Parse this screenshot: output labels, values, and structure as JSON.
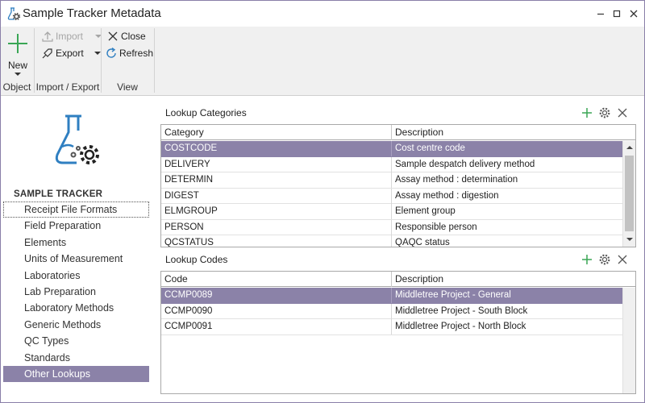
{
  "window": {
    "title": "Sample Tracker Metadata"
  },
  "ribbon": {
    "groups": {
      "object": "Object",
      "import_export": "Import / Export",
      "view": "View"
    },
    "new_label": "New",
    "import_label": "Import",
    "export_label": "Export",
    "close_label": "Close",
    "refresh_label": "Refresh"
  },
  "sidebar": {
    "heading": "SAMPLE TRACKER",
    "items": [
      {
        "label": "Receipt File Formats"
      },
      {
        "label": "Field Preparation"
      },
      {
        "label": "Elements"
      },
      {
        "label": "Units of Measurement"
      },
      {
        "label": "Laboratories"
      },
      {
        "label": "Lab Preparation"
      },
      {
        "label": "Laboratory Methods"
      },
      {
        "label": "Generic Methods"
      },
      {
        "label": "QC Types"
      },
      {
        "label": "Standards"
      },
      {
        "label": "Other Lookups"
      }
    ],
    "focused_index": 0,
    "selected_index": 10
  },
  "categories": {
    "title": "Lookup Categories",
    "columns": [
      "Category",
      "Description"
    ],
    "rows": [
      {
        "category": "COSTCODE",
        "description": "Cost centre code"
      },
      {
        "category": "DELIVERY",
        "description": "Sample despatch delivery method"
      },
      {
        "category": "DETERMIN",
        "description": "Assay method : determination"
      },
      {
        "category": "DIGEST",
        "description": "Assay method : digestion"
      },
      {
        "category": "ELMGROUP",
        "description": "Element group"
      },
      {
        "category": "PERSON",
        "description": "Responsible person"
      },
      {
        "category": "QCSTATUS",
        "description": "QAQC status"
      }
    ],
    "selected_index": 0
  },
  "codes": {
    "title": "Lookup Codes",
    "columns": [
      "Code",
      "Description"
    ],
    "rows": [
      {
        "code": "CCMP0089",
        "description": "Middletree Project - General"
      },
      {
        "code": "CCMP0090",
        "description": "Middletree Project - South Block"
      },
      {
        "code": "CCMP0091",
        "description": "Middletree Project - North Block"
      }
    ],
    "selected_index": 0
  },
  "colors": {
    "selection": "#8b82a8",
    "accent_green": "#3aa655",
    "icon_blue": "#2f7fc1"
  },
  "icons": {
    "add": "plus-icon",
    "settings": "gear-icon",
    "remove": "close-icon"
  }
}
